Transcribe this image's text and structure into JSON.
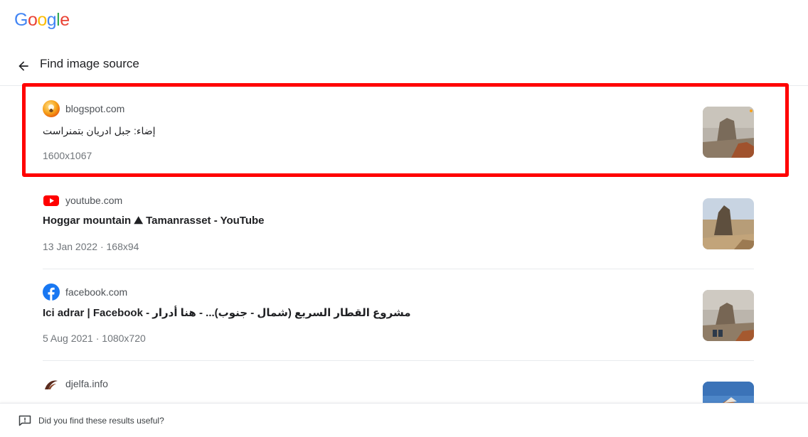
{
  "brand": {
    "logo_letters": [
      "G",
      "o",
      "o",
      "g",
      "l",
      "e"
    ],
    "logo_colors": [
      "#4285F4",
      "#EA4335",
      "#FBBC05",
      "#4285F4",
      "#34A853",
      "#EA4335"
    ]
  },
  "header": {
    "title": "Find image source",
    "back_icon": "arrow-left-icon"
  },
  "results": [
    {
      "site": "blogspot.com",
      "favicon": "blogspot-icon",
      "title": "إضاء: جبل ادريان بتمنراست",
      "meta": "1600x1067",
      "highlighted": true
    },
    {
      "site": "youtube.com",
      "favicon": "youtube-icon",
      "title": "Hoggar mountain ⛰ Tamanrasset - YouTube",
      "meta": "13 Jan 2022 · 168x94",
      "highlighted": false
    },
    {
      "site": "facebook.com",
      "favicon": "facebook-icon",
      "title": "Ici adrar | Facebook - مشروع القطار السريع (شمال - جنوب)... - هنا أدرار",
      "meta": "5 Aug 2021 · 1080x720",
      "highlighted": false
    },
    {
      "site": "djelfa.info",
      "favicon": "djelfa-icon",
      "title": "",
      "meta": "",
      "highlighted": false
    }
  ],
  "footer": {
    "feedback_text": "Did you find these results useful?",
    "feedback_icon": "feedback-icon"
  },
  "colors": {
    "highlight": "#ff0000",
    "youtube": "#ff0000",
    "facebook": "#1877f2"
  }
}
